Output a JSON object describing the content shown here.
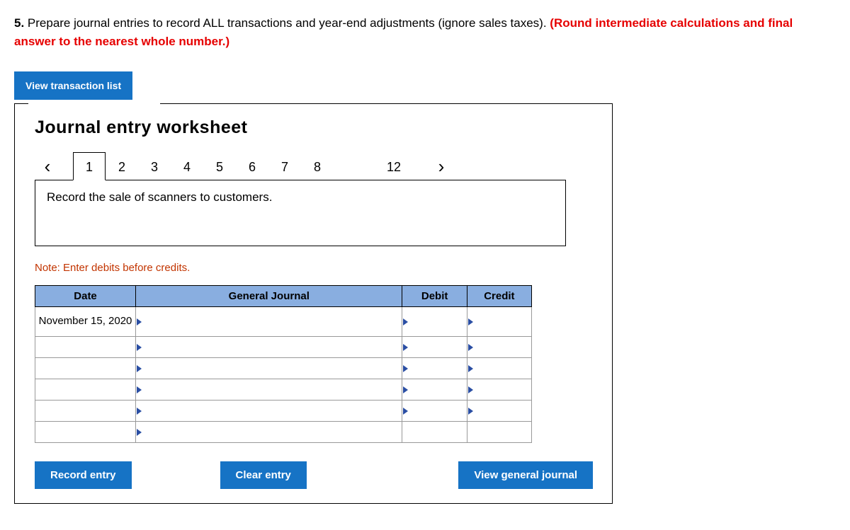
{
  "question": {
    "number": "5.",
    "text_part1": " Prepare journal entries to record ALL transactions and year-end adjustments (ignore sales taxes). ",
    "text_part2": "(Round intermediate calculations and final answer to the nearest whole number.)"
  },
  "buttons": {
    "view_transaction_list": "View transaction list",
    "record_entry": "Record entry",
    "clear_entry": "Clear entry",
    "view_general_journal": "View general journal"
  },
  "worksheet": {
    "title": "Journal entry worksheet",
    "tabs": [
      "1",
      "2",
      "3",
      "4",
      "5",
      "6",
      "7",
      "8",
      "12"
    ],
    "active_tab_index": 0,
    "description": "Record the sale of scanners to customers.",
    "note": "Note: Enter debits before credits."
  },
  "table": {
    "headers": {
      "date": "Date",
      "general_journal": "General Journal",
      "debit": "Debit",
      "credit": "Credit"
    },
    "rows": [
      {
        "date": "November 15, 2020",
        "general_journal": "",
        "debit": "",
        "credit": ""
      },
      {
        "date": "",
        "general_journal": "",
        "debit": "",
        "credit": ""
      },
      {
        "date": "",
        "general_journal": "",
        "debit": "",
        "credit": ""
      },
      {
        "date": "",
        "general_journal": "",
        "debit": "",
        "credit": ""
      },
      {
        "date": "",
        "general_journal": "",
        "debit": "",
        "credit": ""
      },
      {
        "date": "",
        "general_journal": "",
        "debit": "",
        "credit": ""
      }
    ]
  }
}
